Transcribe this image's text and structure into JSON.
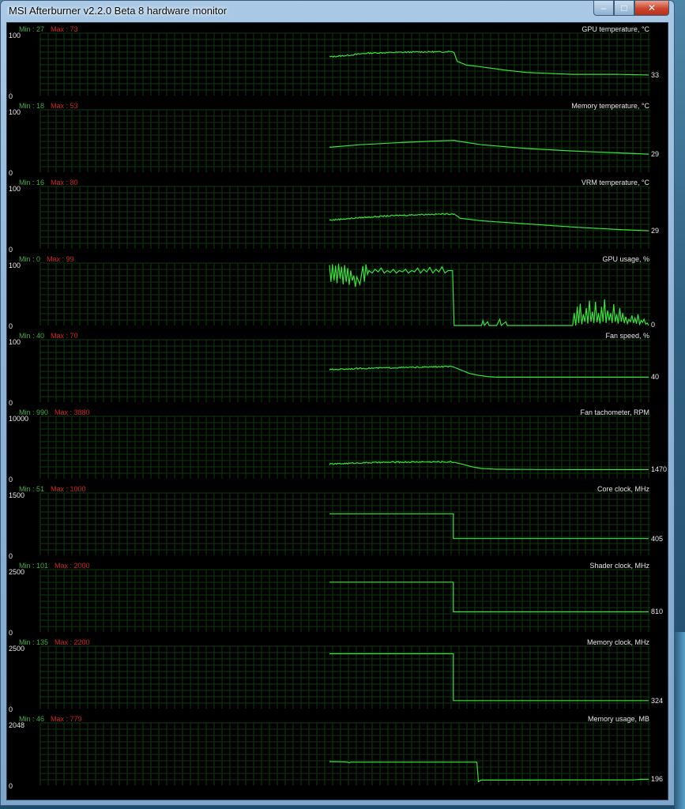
{
  "window": {
    "title": "MSI Afterburner v2.2.0 Beta 8 hardware monitor",
    "caption_minimize": "–",
    "caption_maximize": "□",
    "caption_close": "✕"
  },
  "colors": {
    "graph_line": "#3be23b",
    "grid": "#0f3a0f",
    "min_label": "#3fae3f",
    "max_label": "#d02525"
  },
  "graphs": [
    {
      "title": "GPU temperature, °C",
      "min_label": "Min : 27",
      "max_label": "Max : 73",
      "y_max_label": "100",
      "y_min_label": "0",
      "current_label": "33",
      "scale": [
        0,
        100
      ],
      "series": [
        [
          0,
          62
        ],
        [
          5,
          63
        ],
        [
          10,
          64
        ],
        [
          25,
          68
        ],
        [
          40,
          69
        ],
        [
          60,
          70
        ],
        [
          75,
          70
        ],
        [
          80,
          71
        ],
        [
          82,
          69
        ],
        [
          84,
          55
        ],
        [
          90,
          49
        ],
        [
          100,
          46
        ],
        [
          115,
          41
        ],
        [
          130,
          37
        ],
        [
          160,
          34
        ],
        [
          190,
          34
        ],
        [
          210,
          33
        ]
      ],
      "jitter": true
    },
    {
      "title": "Memory temperature, °C",
      "min_label": "Min : 18",
      "max_label": "Max : 53",
      "y_max_label": "100",
      "y_min_label": "0",
      "current_label": "29",
      "scale": [
        0,
        100
      ],
      "series": [
        [
          0,
          40
        ],
        [
          20,
          44
        ],
        [
          50,
          48
        ],
        [
          70,
          50
        ],
        [
          82,
          51
        ],
        [
          84,
          50
        ],
        [
          100,
          44
        ],
        [
          130,
          38
        ],
        [
          160,
          34
        ],
        [
          190,
          31
        ],
        [
          210,
          29
        ]
      ],
      "jitter": false
    },
    {
      "title": "VRM temperature, °C",
      "min_label": "Min : 16",
      "max_label": "Max : 80",
      "y_max_label": "100",
      "y_min_label": "0",
      "current_label": "29",
      "scale": [
        0,
        100
      ],
      "series": [
        [
          0,
          46
        ],
        [
          20,
          50
        ],
        [
          40,
          53
        ],
        [
          60,
          55
        ],
        [
          80,
          56
        ],
        [
          82,
          56
        ],
        [
          86,
          49
        ],
        [
          100,
          45
        ],
        [
          130,
          40
        ],
        [
          160,
          35
        ],
        [
          190,
          31
        ],
        [
          210,
          29
        ]
      ],
      "jitter": true
    },
    {
      "title": "GPU usage, %",
      "min_label": "Min : 0",
      "max_label": "Max : 99",
      "y_max_label": "100",
      "y_min_label": "0",
      "current_label": "0",
      "scale": [
        0,
        100
      ],
      "series": [
        [
          0,
          97
        ],
        [
          1,
          70
        ],
        [
          2,
          98
        ],
        [
          3,
          72
        ],
        [
          4,
          96
        ],
        [
          5,
          68
        ],
        [
          6,
          99
        ],
        [
          7,
          75
        ],
        [
          8,
          94
        ],
        [
          9,
          66
        ],
        [
          10,
          97
        ],
        [
          11,
          70
        ],
        [
          12,
          92
        ],
        [
          13,
          65
        ],
        [
          14,
          88
        ],
        [
          15,
          72
        ],
        [
          16,
          80
        ],
        [
          17,
          62
        ],
        [
          18,
          78
        ],
        [
          20,
          66
        ],
        [
          22,
          95
        ],
        [
          23,
          70
        ],
        [
          24,
          98
        ],
        [
          25,
          82
        ],
        [
          26,
          88
        ],
        [
          28,
          84
        ],
        [
          30,
          90
        ],
        [
          32,
          86
        ],
        [
          34,
          92
        ],
        [
          36,
          84
        ],
        [
          38,
          88
        ],
        [
          40,
          85
        ],
        [
          42,
          90
        ],
        [
          44,
          84
        ],
        [
          46,
          88
        ],
        [
          48,
          86
        ],
        [
          50,
          90
        ],
        [
          52,
          84
        ],
        [
          54,
          88
        ],
        [
          56,
          86
        ],
        [
          58,
          92
        ],
        [
          60,
          84
        ],
        [
          62,
          90
        ],
        [
          64,
          86
        ],
        [
          66,
          93
        ],
        [
          68,
          84
        ],
        [
          70,
          90
        ],
        [
          72,
          86
        ],
        [
          74,
          94
        ],
        [
          76,
          84
        ],
        [
          78,
          88
        ],
        [
          80,
          88
        ],
        [
          81,
          88
        ],
        [
          82,
          0
        ],
        [
          90,
          0
        ],
        [
          100,
          0
        ],
        [
          101,
          8
        ],
        [
          102,
          0
        ],
        [
          104,
          6
        ],
        [
          105,
          0
        ],
        [
          110,
          0
        ],
        [
          112,
          10
        ],
        [
          113,
          0
        ],
        [
          116,
          6
        ],
        [
          117,
          0
        ],
        [
          130,
          0
        ],
        [
          150,
          0
        ],
        [
          160,
          0
        ],
        [
          161,
          20
        ],
        [
          162,
          0
        ],
        [
          163,
          30
        ],
        [
          164,
          4
        ],
        [
          165,
          35
        ],
        [
          166,
          2
        ],
        [
          167,
          18
        ],
        [
          168,
          6
        ],
        [
          169,
          28
        ],
        [
          170,
          3
        ],
        [
          171,
          40
        ],
        [
          172,
          6
        ],
        [
          173,
          22
        ],
        [
          174,
          4
        ],
        [
          175,
          38
        ],
        [
          176,
          5
        ],
        [
          177,
          20
        ],
        [
          178,
          3
        ],
        [
          179,
          30
        ],
        [
          180,
          6
        ],
        [
          181,
          42
        ],
        [
          182,
          4
        ],
        [
          183,
          24
        ],
        [
          184,
          8
        ],
        [
          185,
          20
        ],
        [
          186,
          4
        ],
        [
          187,
          34
        ],
        [
          188,
          6
        ],
        [
          189,
          18
        ],
        [
          190,
          3
        ],
        [
          191,
          28
        ],
        [
          192,
          6
        ],
        [
          193,
          20
        ],
        [
          194,
          4
        ],
        [
          195,
          14
        ],
        [
          196,
          3
        ],
        [
          197,
          10
        ],
        [
          198,
          6
        ],
        [
          199,
          16
        ],
        [
          200,
          4
        ],
        [
          201,
          12
        ],
        [
          202,
          3
        ],
        [
          203,
          18
        ],
        [
          204,
          2
        ],
        [
          205,
          8
        ],
        [
          206,
          5
        ],
        [
          207,
          10
        ],
        [
          208,
          2
        ],
        [
          209,
          4
        ],
        [
          210,
          0
        ]
      ],
      "jitter": false
    },
    {
      "title": "Fan speed, %",
      "min_label": "Min : 40",
      "max_label": "Max : 70",
      "y_max_label": "100",
      "y_min_label": "0",
      "current_label": "40",
      "scale": [
        0,
        100
      ],
      "series": [
        [
          0,
          52
        ],
        [
          20,
          54
        ],
        [
          40,
          55
        ],
        [
          60,
          56
        ],
        [
          78,
          57
        ],
        [
          82,
          56
        ],
        [
          86,
          52
        ],
        [
          92,
          46
        ],
        [
          98,
          43
        ],
        [
          104,
          41
        ],
        [
          110,
          40
        ],
        [
          140,
          40
        ],
        [
          170,
          40
        ],
        [
          210,
          40
        ]
      ],
      "jitter": true
    },
    {
      "title": "Fan tachometer, RPM",
      "min_label": "Min : 990",
      "max_label": "Max : 3880",
      "y_max_label": "10000",
      "y_min_label": "0",
      "current_label": "1470",
      "scale": [
        0,
        10000
      ],
      "series": [
        [
          0,
          2350
        ],
        [
          10,
          2450
        ],
        [
          20,
          2550
        ],
        [
          40,
          2650
        ],
        [
          60,
          2700
        ],
        [
          80,
          2700
        ],
        [
          82,
          2650
        ],
        [
          88,
          2300
        ],
        [
          94,
          1900
        ],
        [
          100,
          1650
        ],
        [
          110,
          1520
        ],
        [
          140,
          1480
        ],
        [
          170,
          1470
        ],
        [
          210,
          1470
        ]
      ],
      "jitter": true
    },
    {
      "title": "Core clock, MHz",
      "min_label": "Min : 51",
      "max_label": "Max : 1000",
      "y_max_label": "1500",
      "y_min_label": "0",
      "current_label": "405",
      "scale": [
        0,
        1500
      ],
      "series": [
        [
          0,
          1000
        ],
        [
          80,
          1000
        ],
        [
          81.5,
          1000
        ],
        [
          81.5,
          405
        ],
        [
          210,
          405
        ]
      ],
      "jitter": false
    },
    {
      "title": "Shader clock, MHz",
      "min_label": "Min : 101",
      "max_label": "Max : 2000",
      "y_max_label": "2500",
      "y_min_label": "0",
      "current_label": "810",
      "scale": [
        0,
        2500
      ],
      "series": [
        [
          0,
          2000
        ],
        [
          80,
          2000
        ],
        [
          81.5,
          2000
        ],
        [
          81.5,
          810
        ],
        [
          210,
          810
        ]
      ],
      "jitter": false
    },
    {
      "title": "Memory clock, MHz",
      "min_label": "Min : 135",
      "max_label": "Max : 2200",
      "y_max_label": "2500",
      "y_min_label": "0",
      "current_label": "324",
      "scale": [
        0,
        2500
      ],
      "series": [
        [
          0,
          2200
        ],
        [
          80,
          2200
        ],
        [
          81.5,
          2200
        ],
        [
          81.5,
          324
        ],
        [
          210,
          324
        ]
      ],
      "jitter": false
    },
    {
      "title": "Memory usage, MB",
      "min_label": "Min : 46",
      "max_label": "Max : 779",
      "y_max_label": "2048",
      "y_min_label": "0",
      "current_label": "196",
      "scale": [
        0,
        2048
      ],
      "series": [
        [
          0,
          779
        ],
        [
          10,
          770
        ],
        [
          12,
          760
        ],
        [
          13,
          740
        ],
        [
          14,
          760
        ],
        [
          25,
          760
        ],
        [
          60,
          760
        ],
        [
          90,
          760
        ],
        [
          97,
          760
        ],
        [
          98,
          120
        ],
        [
          99,
          150
        ],
        [
          100,
          170
        ],
        [
          130,
          170
        ],
        [
          160,
          175
        ],
        [
          200,
          175
        ],
        [
          205,
          196
        ],
        [
          210,
          196
        ]
      ],
      "jitter": false
    }
  ]
}
